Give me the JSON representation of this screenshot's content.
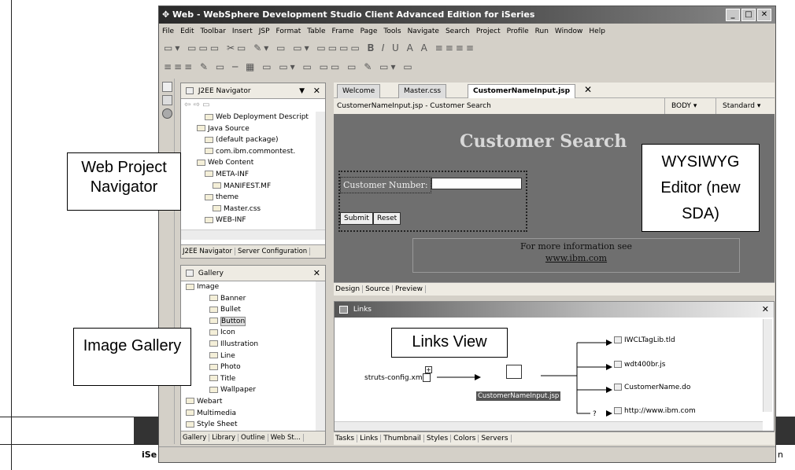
{
  "window": {
    "title": "Web - WebSphere Development Studio Client Advanced Edition for iSeries"
  },
  "menu": [
    "File",
    "Edit",
    "Toolbar",
    "Insert",
    "JSP",
    "Format",
    "Table",
    "Frame",
    "Page",
    "Tools",
    "Navigate",
    "Search",
    "Project",
    "Profile",
    "Run",
    "Window",
    "Help"
  ],
  "navigator": {
    "title": "J2EE Navigator",
    "tree": [
      "Web Deployment Descript",
      "Java Source",
      "(default package)",
      "com.ibm.commontest.",
      "Web Content",
      "META-INF",
      "MANIFEST.MF",
      "theme",
      "Master.css",
      "WEB-INF"
    ],
    "tabs": [
      "J2EE Navigator",
      "Server Configuration"
    ]
  },
  "gallery": {
    "title": "Gallery",
    "tree": [
      "Image",
      "Banner",
      "Bullet",
      "Button",
      "Icon",
      "Illustration",
      "Line",
      "Photo",
      "Title",
      "Wallpaper",
      "Webart",
      "Multimedia",
      "Style Sheet"
    ],
    "tabs": [
      "Gallery",
      "Library",
      "Outline",
      "Web St..."
    ]
  },
  "editor": {
    "tabs": [
      "Welcome",
      "Master.css",
      "CustomerNameInput.jsp"
    ],
    "breadcrumb": "CustomerNameInput.jsp - Customer Search",
    "body_select": "BODY",
    "standard_select": "Standard",
    "heading": "Customer Search",
    "field_label": "Customer Number:",
    "buttons": [
      "Submit",
      "Reset"
    ],
    "info_text": "For more information see",
    "info_link": "www.ibm.com",
    "view_tabs": [
      "Design",
      "Source",
      "Preview"
    ]
  },
  "links": {
    "title": "Links",
    "source": "struts-config.xml",
    "center": "CustomerNameInput.jsp",
    "targets": [
      "IWCLTagLib.tld",
      "wdt400br.js",
      "CustomerName.do",
      "http://www.ibm.com"
    ],
    "bottom_tabs": [
      "Tasks",
      "Links",
      "Thumbnail",
      "Styles",
      "Colors",
      "Servers"
    ]
  },
  "callouts": {
    "navigator": "Web Project Navigator",
    "wysiwyg": "WYSIWYG Editor (new SDA)",
    "links": "Links View",
    "gallery": "Image Gallery"
  },
  "slide_footer": {
    "left": "iSe",
    "right": "n"
  },
  "colors": {
    "design_bg": "#6f6f6f",
    "heading": "#d8d8d8",
    "titlebar": "#2a2a2a"
  }
}
